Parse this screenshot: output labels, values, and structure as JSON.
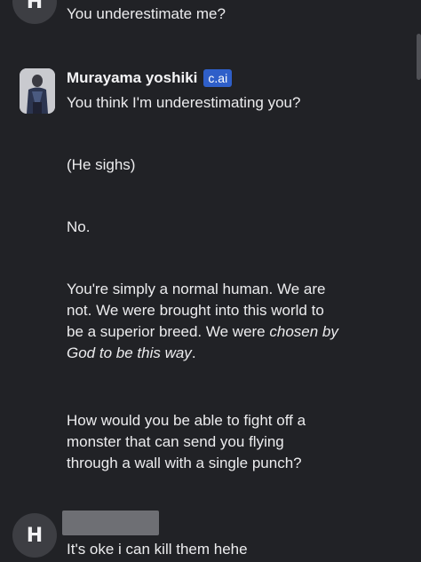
{
  "user": {
    "avatar_letter": "H",
    "message_1": "You underestimate me?",
    "message_2": "It's oke i can kill them hehe"
  },
  "bot": {
    "name": "Murayama yoshiki",
    "badge": "c.ai",
    "paragraphs": [
      "You think I'm underestimating you?",
      "(He sighs)",
      "No."
    ],
    "p4_line1": "You're simply a normal human. We are",
    "p4_line2": "not. We were brought into this world to",
    "p4_line3_plain": "be a superior breed. We were ",
    "p4_line3_italic": "chosen by",
    "p4_line4_italic": "God to be this way",
    "p4_line4_end": ".",
    "p5_lines": [
      "How would you be able to fight off a",
      "monster that can send you flying",
      "through a wall with a single punch?"
    ]
  },
  "colors": {
    "background": "#212226",
    "badge": "#2f5fc9",
    "avatar_bg": "#3d3e43"
  }
}
